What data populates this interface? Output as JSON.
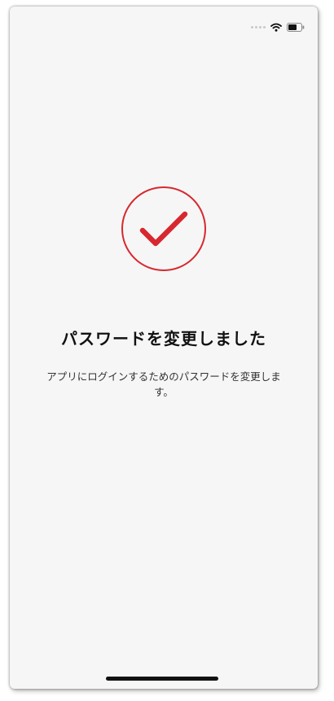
{
  "screen": {
    "title": "パスワードを変更しました",
    "message": "アプリにログインするためのパスワードを変更します。"
  },
  "status_bar": {
    "icons": [
      "signal-dots-icon",
      "wifi-icon",
      "battery-icon"
    ]
  },
  "success_icon": {
    "name": "check-circle-icon",
    "color": "#d7282f"
  },
  "colors": {
    "background": "#f6f6f6",
    "title": "#111111",
    "message": "#333333",
    "accent": "#d7282f"
  }
}
